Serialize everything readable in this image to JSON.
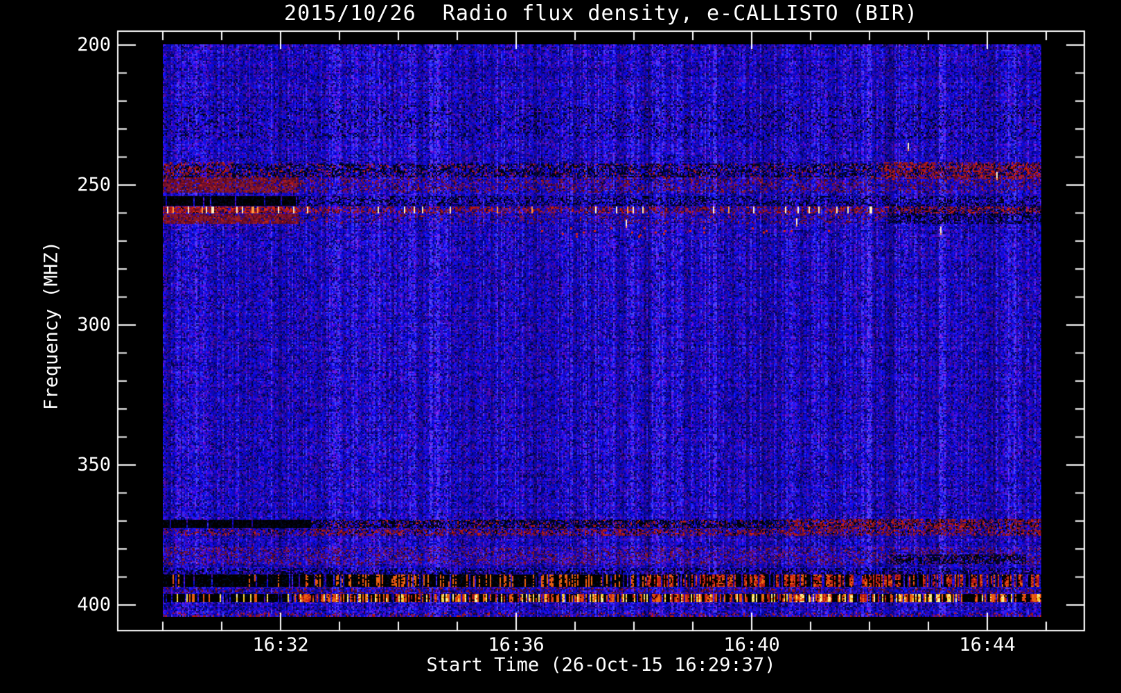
{
  "chart_data": {
    "type": "heatmap",
    "title": "2015/10/26  Radio flux density, e-CALLISTO (BIR)",
    "xlabel": "Start Time (26-Oct-15 16:29:37)",
    "ylabel": "Frequency (MHZ)",
    "x_axis": {
      "start_time_label": "16:29:37",
      "data_start_clock": "16:30:00",
      "data_span_minutes": 14.92,
      "frame_span_minutes": [
        -1.25,
        15.65
      ],
      "major_ticks": [
        {
          "label": "16:32",
          "t": 2
        },
        {
          "label": "16:36",
          "t": 6
        },
        {
          "label": "16:40",
          "t": 10
        },
        {
          "label": "16:44",
          "t": 14
        }
      ],
      "minor_tick_step_minutes": 1
    },
    "y_axis": {
      "unit": "MHz",
      "range": [
        199.75,
        404.2
      ],
      "major_ticks": [
        {
          "label": "200",
          "f": 200
        },
        {
          "label": "250",
          "f": 250
        },
        {
          "label": "300",
          "f": 300
        },
        {
          "label": "350",
          "f": 350
        },
        {
          "label": "400",
          "f": 400
        }
      ],
      "minor_tick_step_mhz": 10,
      "direction": "increasing-downward"
    },
    "colormap": {
      "base_blue_hue": 242,
      "purple_hue": 262,
      "black": "#000000",
      "navy": [
        "#000730",
        "#02021a",
        "#050517"
      ],
      "maroon": [
        "#6a0a28",
        "#7c1430",
        "#58081e",
        "#8c1c2c"
      ],
      "red": [
        "#b01616",
        "#c42012",
        "#a01414",
        "#d42410"
      ],
      "orange": [
        "#f05a10",
        "#e87010",
        "#e04a10"
      ],
      "yellow": [
        "#f8c820",
        "#f0e060",
        "#fff0a0"
      ],
      "bright": [
        "#ffe9b0",
        "#ff9a40",
        "#fff3cf"
      ]
    },
    "features": [
      {
        "type": "dark_speckle",
        "f0": 221.5,
        "f1": 233.5,
        "t0": 0,
        "t1": 14.92,
        "density": 0.1
      },
      {
        "type": "dark_speckle",
        "f0": 242.3,
        "f1": 247.0,
        "t0": 0,
        "t1": 14.92,
        "density": 0.38
      },
      {
        "type": "red_speckle",
        "f0": 242.3,
        "f1": 247.0,
        "t0": 0,
        "t1": 14.92,
        "density": 0.1
      },
      {
        "type": "red_speckle",
        "f0": 241.8,
        "f1": 247.5,
        "t0": 12.2,
        "t1": 14.92,
        "density": 0.45
      },
      {
        "type": "red_speckle",
        "f0": 241.8,
        "f1": 247.5,
        "t0": 0,
        "t1": 1.2,
        "density": 0.3
      },
      {
        "type": "maroon_band",
        "f0": 247.2,
        "f1": 252.6,
        "t0": 0,
        "t1": 2.3,
        "density": 0.8
      },
      {
        "type": "maroon_band",
        "f0": 247.2,
        "f1": 252.6,
        "t0": 2.3,
        "t1": 14.92,
        "density": 0.22
      },
      {
        "type": "black_band",
        "f0": 254.0,
        "f1": 257.3,
        "t0": 0,
        "t1": 2.3,
        "density": 0.85
      },
      {
        "type": "dark_speckle",
        "f0": 254.0,
        "f1": 257.3,
        "t0": 2.3,
        "t1": 14.92,
        "density": 0.3
      },
      {
        "type": "navy_band",
        "f0": 257.5,
        "f1": 263.8,
        "t0": 12.3,
        "t1": 14.92,
        "density": 0.45
      },
      {
        "type": "red_line_strong",
        "f0": 257.6,
        "f1": 260.1,
        "t0": 0,
        "t1": 2.3,
        "density": 0.85
      },
      {
        "type": "red_line",
        "f0": 257.6,
        "f1": 260.1,
        "t0": 2.3,
        "t1": 14.92,
        "density": 0.4
      },
      {
        "type": "maroon_band",
        "f0": 260.3,
        "f1": 263.7,
        "t0": 0,
        "t1": 2.3,
        "density": 0.85
      },
      {
        "type": "maroon_band",
        "f0": 260.3,
        "f1": 263.7,
        "t0": 2.3,
        "t1": 12.3,
        "density": 0.13
      },
      {
        "type": "red_specks_sparse",
        "f0": 265.0,
        "f1": 268.5,
        "t0": 6.3,
        "t1": 11.3,
        "density": 0.012
      },
      {
        "type": "black_band",
        "f0": 369.6,
        "f1": 372.6,
        "t0": 0,
        "t1": 2.5,
        "density": 0.88
      },
      {
        "type": "dark_speckle",
        "f0": 369.6,
        "f1": 372.6,
        "t0": 2.5,
        "t1": 10.6,
        "density": 0.5
      },
      {
        "type": "red_speckle",
        "f0": 369.6,
        "f1": 372.6,
        "t0": 2.5,
        "t1": 10.6,
        "density": 0.12
      },
      {
        "type": "red_speckle",
        "f0": 369.3,
        "f1": 372.6,
        "t0": 10.6,
        "t1": 14.92,
        "density": 0.55
      },
      {
        "type": "dark_speckle",
        "f0": 369.3,
        "f1": 372.6,
        "t0": 10.6,
        "t1": 14.92,
        "density": 0.18
      },
      {
        "type": "red_dotted",
        "f0": 372.8,
        "f1": 375.3,
        "t0": 0,
        "t1": 2.5,
        "density": 0.3
      },
      {
        "type": "red_dotted",
        "f0": 372.8,
        "f1": 375.3,
        "t0": 2.5,
        "t1": 14.92,
        "density": 0.5
      },
      {
        "type": "maroon_speckle",
        "f0": 379.3,
        "f1": 385.6,
        "t0": 0,
        "t1": 14.92,
        "density": 0.28
      },
      {
        "type": "navy_band",
        "f0": 381.9,
        "f1": 385.4,
        "t0": 12.35,
        "t1": 14.65,
        "density": 0.55
      },
      {
        "type": "dark_speckle",
        "f0": 386.8,
        "f1": 389.0,
        "t0": 0,
        "t1": 14.92,
        "density": 0.3
      },
      {
        "type": "black_streaks",
        "f0": 389.2,
        "f1": 393.2,
        "t0": 0,
        "t1": 2.3,
        "density": 0.88,
        "accent": 0.05
      },
      {
        "type": "black_streaks",
        "f0": 389.2,
        "f1": 393.2,
        "t0": 2.3,
        "t1": 8.2,
        "density": 0.62,
        "accent": 0.28
      },
      {
        "type": "red_streaks",
        "f0": 389.2,
        "f1": 393.2,
        "t0": 8.2,
        "t1": 14.92,
        "density": 0.85
      },
      {
        "type": "blue_red_speckle",
        "f0": 393.7,
        "f1": 395.9,
        "t0": 0,
        "t1": 14.92,
        "density": 0.22
      },
      {
        "type": "fire_sparse",
        "f0": 396.1,
        "f1": 399.0,
        "t0": 0,
        "t1": 2.3,
        "density": 0.55
      },
      {
        "type": "fire",
        "f0": 396.1,
        "f1": 399.0,
        "t0": 2.3,
        "t1": 14.92,
        "density": 0.92
      },
      {
        "type": "red_speckle",
        "f0": 402.6,
        "f1": 404.1,
        "t0": 0,
        "t1": 14.92,
        "density": 0.22
      }
    ],
    "bright_points": [
      {
        "t": 12.65,
        "f": 234.8
      },
      {
        "t": 14.15,
        "f": 245.3
      },
      {
        "t": 13.2,
        "f": 264.9
      },
      {
        "t": 7.86,
        "f": 262.4
      },
      {
        "t": 10.75,
        "f": 261.9
      }
    ],
    "legend_position": "none",
    "grid": false
  }
}
